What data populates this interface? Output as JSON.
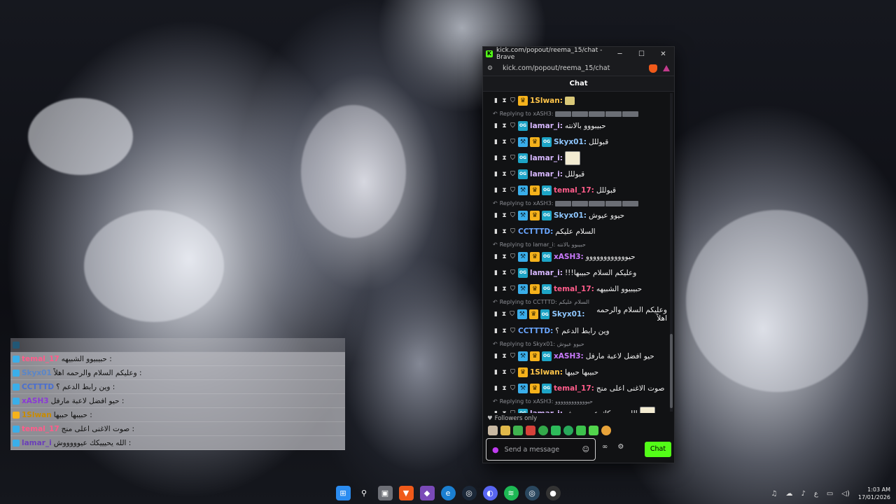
{
  "window": {
    "title": "kick.com/popout/reema_15/chat - Brave",
    "url": "kick.com/popout/reema_15/chat",
    "minimize": "─",
    "maximize": "☐",
    "close": "✕"
  },
  "chat": {
    "header": "Chat",
    "messages": [
      {
        "type": "msg",
        "user": "1Slwan:",
        "color": "c-slwan",
        "badges": [
          "vip"
        ],
        "text": "",
        "emote": "small"
      },
      {
        "type": "reply",
        "text": "Replying to xASH3:",
        "emotes": 5
      },
      {
        "type": "msg",
        "user": "lamar_i:",
        "color": "c-lamar",
        "badges": [
          "og"
        ],
        "text": "حبيبووو بالانته"
      },
      {
        "type": "msg",
        "user": "Skyx01:",
        "color": "c-sky",
        "badges": [
          "sub",
          "vip",
          "og"
        ],
        "text": "قبوللل"
      },
      {
        "type": "msg",
        "user": "lamar_i:",
        "color": "c-lamar",
        "badges": [
          "og"
        ],
        "text": "",
        "emote": "large"
      },
      {
        "type": "msg",
        "user": "lamar_i:",
        "color": "c-lamar",
        "badges": [
          "og"
        ],
        "text": "قبوللل"
      },
      {
        "type": "msg",
        "user": "temal_17:",
        "color": "c-temal",
        "badges": [
          "sub",
          "vip",
          "og"
        ],
        "text": "قبوللل"
      },
      {
        "type": "reply",
        "text": "Replying to xASH3:",
        "emotes": 5
      },
      {
        "type": "msg",
        "user": "Skyx01:",
        "color": "c-sky",
        "badges": [
          "sub",
          "vip",
          "og"
        ],
        "text": "حيوو عيوش"
      },
      {
        "type": "msg",
        "user": "CCTTTD:",
        "color": "c-cc",
        "badges": [],
        "text": "السلام عليكم"
      },
      {
        "type": "reply",
        "text": "Replying to lamar_i: حبيبوو بالانته",
        "emotes": 0
      },
      {
        "type": "msg",
        "user": "xASH3:",
        "color": "c-xash",
        "badges": [
          "sub",
          "vip",
          "og"
        ],
        "text": "حيوووووووووووو"
      },
      {
        "type": "msg",
        "user": "lamar_i:",
        "color": "c-lamar",
        "badges": [
          "og"
        ],
        "text": "وعليكم السلام حبيبها!!!"
      },
      {
        "type": "msg",
        "user": "temal_17:",
        "color": "c-temal",
        "badges": [
          "sub",
          "vip",
          "og"
        ],
        "text": "حبيبيوو الشبيهه"
      },
      {
        "type": "reply",
        "text": "Replying to CCTTTD: السلام عليكم",
        "emotes": 0
      },
      {
        "type": "msg",
        "user": "Skyx01:",
        "color": "c-sky",
        "badges": [
          "sub",
          "vip",
          "og"
        ],
        "text": "وعليكم السلام والرحمه اهلاً"
      },
      {
        "type": "msg",
        "user": "CCTTTD:",
        "color": "c-cc",
        "badges": [],
        "text": "وين رابط الدعم ؟"
      },
      {
        "type": "reply",
        "text": "Replying to Skyx01: حيوو عيوش",
        "emotes": 0
      },
      {
        "type": "msg",
        "user": "xASH3:",
        "color": "c-xash",
        "badges": [
          "sub",
          "vip",
          "og"
        ],
        "text": "حيو افضل لاعبة مارفل"
      },
      {
        "type": "msg",
        "user": "1Slwan:",
        "color": "c-slwan",
        "badges": [
          "vip"
        ],
        "text": "حبيبها حبيها"
      },
      {
        "type": "msg",
        "user": "temal_17:",
        "color": "c-temal",
        "badges": [
          "sub",
          "vip",
          "og"
        ],
        "text": "صوت الاغنى اعلى منج"
      },
      {
        "type": "reply",
        "text": "Replying to xASH3: حيوووووووووووو",
        "emotes": 0
      },
      {
        "type": "msg",
        "user": "lamar_i:",
        "color": "c-lamar",
        "badges": [
          "og"
        ],
        "text": "الله يحيييكك عيوووووش",
        "emote": "large"
      }
    ],
    "followers_only": "Followers only",
    "input_placeholder": "Send a message",
    "chat_button": "Chat"
  },
  "overlay": [
    {
      "user": "",
      "text": ""
    },
    {
      "user": "temal_17",
      "text": ": حبيبيوو الشبيهه"
    },
    {
      "user": "Skyx01",
      "text": ": وعليكم السلام والرحمه اهلاً"
    },
    {
      "user": "CCTTTD",
      "text": ": وين رابط الدعم ؟"
    },
    {
      "user": "xASH3",
      "text": ": حيو افضل لاعبة مارفل"
    },
    {
      "user": "1Slwan",
      "text": ": حبيبها حبيها"
    },
    {
      "user": "temal_17",
      "text": ": صوت الاغنى اعلى منج"
    },
    {
      "user": "lamar_i",
      "text": ": الله يحيييكك عيوووووش"
    }
  ],
  "taskbar": {
    "time": "1:03 AM",
    "date": "17/01/2026",
    "lang": "ع"
  },
  "colors": {
    "kick_green": "#53fc18",
    "mic_purple": "#c03cf0"
  }
}
